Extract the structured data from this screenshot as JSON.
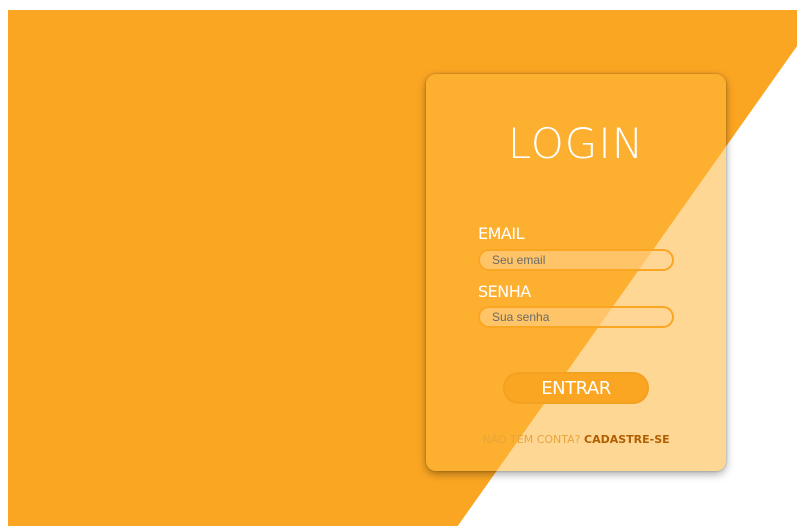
{
  "login": {
    "title": "LOGIN",
    "email_label": "EMAIL",
    "email_placeholder": "Seu email",
    "email_value": "",
    "senha_label": "SENHA",
    "senha_placeholder": "Sua senha",
    "senha_value": "",
    "submit_label": "ENTRAR",
    "no_account_text": "NÃO TEM CONTA?",
    "signup_link": "CADASTRE-SE"
  },
  "colors": {
    "brand_orange": "#fba623",
    "background_white": "#ffffff",
    "link_dark_orange": "#b05e00"
  }
}
